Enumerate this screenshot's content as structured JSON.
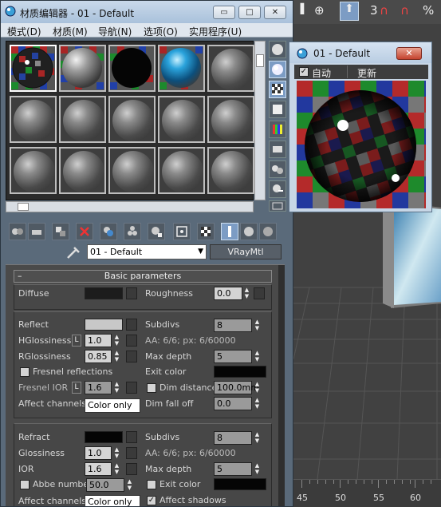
{
  "editor": {
    "title": "材质编辑器 - 01 - Default",
    "window_buttons": {
      "minimize": "▭",
      "restore": "□",
      "close": "✕"
    },
    "menu": [
      "模式(D)",
      "材质(M)",
      "导航(N)",
      "选项(O)",
      "实用程序(U)"
    ]
  },
  "material": {
    "name": "01 - Default",
    "type": "VRayMtl",
    "rollout_title": "Basic parameters",
    "rollout_toggle": "–",
    "dropdown_arrow": "▼"
  },
  "diffuse": {
    "label": "Diffuse",
    "roughness_label": "Roughness",
    "roughness": "0.0",
    "color": "#1c1c1c"
  },
  "reflect": {
    "label": "Reflect",
    "color": "#c8c8c8",
    "hglossiness_label": "HGlossiness",
    "hglossiness": "1.0",
    "rglossiness_label": "RGlossiness",
    "rglossiness": "0.85",
    "lock_label": "L",
    "fresnel_label": "Fresnel reflections",
    "fresnel_ior_label": "Fresnel IOR",
    "fresnel_ior": "1.6",
    "affect_channels_label": "Affect channels",
    "affect_channels": "Color only",
    "subdivs_label": "Subdivs",
    "subdivs": "8",
    "aa_info": "AA: 6/6; px: 6/60000",
    "max_depth_label": "Max depth",
    "max_depth": "5",
    "exit_color_label": "Exit color",
    "exit_color": "#050505",
    "dim_distance_label": "Dim distance",
    "dim_distance": "100.0mm",
    "dim_falloff_label": "Dim fall off",
    "dim_falloff": "0.0"
  },
  "refract": {
    "label": "Refract",
    "color": "#050505",
    "glossiness_label": "Glossiness",
    "glossiness": "1.0",
    "ior_label": "IOR",
    "ior": "1.6",
    "abbe_label": "Abbe number",
    "abbe": "50.0",
    "affect_channels_label": "Affect channels",
    "affect_channels": "Color only",
    "subdivs_label": "Subdivs",
    "subdivs": "8",
    "aa_info": "AA: 6/6; px: 6/60000",
    "max_depth_label": "Max depth",
    "max_depth": "5",
    "exit_color_label": "Exit color",
    "exit_color": "#050505",
    "affect_shadows_label": "Affect shadows",
    "affect_shadows_checked": "✓"
  },
  "sample_window": {
    "title": "01 - Default",
    "close": "✕",
    "auto_label": "自动",
    "auto_checked": "✓",
    "update_label": "更新"
  },
  "viewport": {
    "toolbar": [
      "⊕",
      "⬆",
      "3",
      "∩",
      "∩",
      "%"
    ],
    "ruler_labels": [
      "45",
      "50",
      "55",
      "60"
    ]
  }
}
